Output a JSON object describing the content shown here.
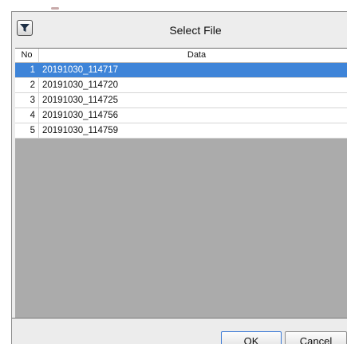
{
  "dialog": {
    "title": "Select File",
    "filter_icon": "filter-icon"
  },
  "table": {
    "columns": {
      "no": "No",
      "data": "Data"
    },
    "rows": [
      {
        "no": "1",
        "data": "20191030_114717",
        "selected": true
      },
      {
        "no": "2",
        "data": "20191030_114720",
        "selected": false
      },
      {
        "no": "3",
        "data": "20191030_114725",
        "selected": false
      },
      {
        "no": "4",
        "data": "20191030_114756",
        "selected": false
      },
      {
        "no": "5",
        "data": "20191030_114759",
        "selected": false
      }
    ]
  },
  "buttons": {
    "ok_label": "OK",
    "cancel_label": "Cancel"
  },
  "colors": {
    "selection": "#3e84d8",
    "empty_area": "#ababab"
  }
}
